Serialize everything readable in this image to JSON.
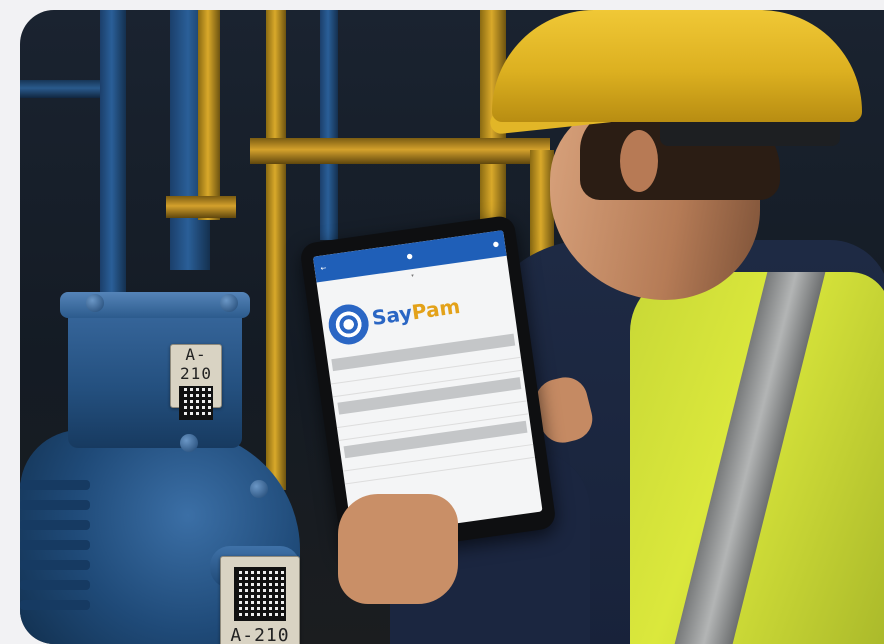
{
  "asset_tag_top": "A-210",
  "asset_tag_bottom": "A-210",
  "tablet_app": {
    "brand_say": "Say",
    "brand_pam": "Pam"
  },
  "colors": {
    "helmet": "#dcb020",
    "vest": "#d4e23a",
    "motor": "#24507f",
    "app_bar": "#1f5fb8",
    "brand_blue": "#2a66c4",
    "brand_orange": "#e3a21a"
  }
}
